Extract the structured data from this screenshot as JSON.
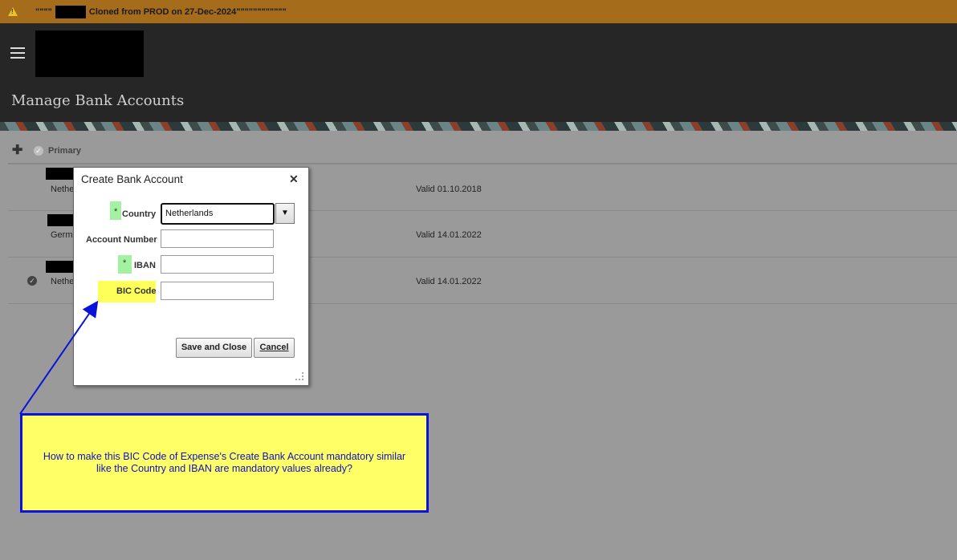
{
  "banner": {
    "prefix_quotes": "\"\"\"\"",
    "text": "Cloned from PROD on 27-Dec-2024",
    "suffix_quotes": "\"\"\"\"\"\"\"\"\"\"\"\""
  },
  "header": {
    "page_title": "Manage Bank Accounts"
  },
  "toolbar": {
    "primary_label": "Primary"
  },
  "accounts": [
    {
      "country": "Nethe",
      "valid": "Valid 01.10.2018",
      "primary": false
    },
    {
      "country": "Germ",
      "valid": "Valid 14.01.2022",
      "primary": false
    },
    {
      "country": "Nethe",
      "valid": "Valid 14.01.2022",
      "primary": true
    }
  ],
  "dialog": {
    "title": "Create Bank Account",
    "close_glyph": "✕",
    "country": {
      "star": "*",
      "label": "Country",
      "value": "Netherlands"
    },
    "account_number": {
      "label": "Account Number",
      "value": ""
    },
    "iban": {
      "star": "*",
      "label": "IBAN",
      "value": ""
    },
    "bic": {
      "label": "BIC Code",
      "value": ""
    },
    "save_label": "Save and Close",
    "cancel_label": "Cancel"
  },
  "annotation": {
    "text": "How to make this BIC Code of Expense's Create Bank Account mandatory similar like the Country and IBAN are mandatory values already?"
  },
  "colors": {
    "banner_bg": "#a56c1c",
    "header_bg": "#262626",
    "required_highlight": "#a2f2a2",
    "bic_highlight": "#ffff5a",
    "annotation_border": "#0a14d8"
  }
}
